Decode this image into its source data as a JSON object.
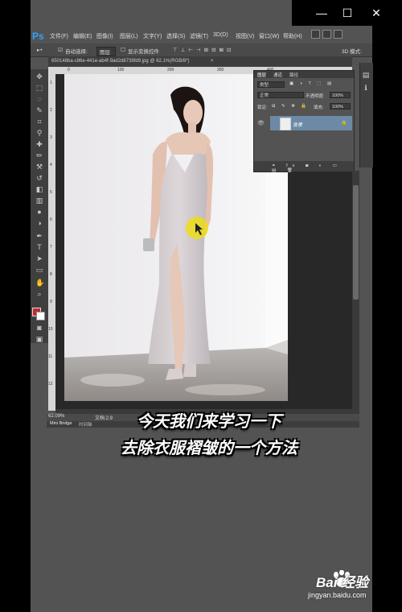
{
  "window": {
    "minimize": "—",
    "maximize": "☐",
    "close": "✕"
  },
  "app": {
    "logo": "Ps"
  },
  "menu": [
    "文件(F)",
    "编辑(E)",
    "图像(I)",
    "图层(L)",
    "文字(Y)",
    "选择(S)",
    "滤镜(T)",
    "3D(D)",
    "视图(V)",
    "窗口(W)",
    "帮助(H)"
  ],
  "options": {
    "auto_select": "自动选择:",
    "group": "图层",
    "show_transform": "显示变换控件",
    "mode3d": "3D 模式:"
  },
  "document": {
    "tab_title": "650148ba-c86e-441e-ab4f-9ad2d8739fd9.jpg @ 62.1%(RGB/8*)",
    "close": "×"
  },
  "ruler": {
    "top": [
      "0",
      "100",
      "200",
      "300",
      "400"
    ],
    "left": [
      "1",
      "2",
      "3",
      "4",
      "5",
      "6",
      "7",
      "8",
      "9",
      "10",
      "11",
      "12"
    ]
  },
  "layers_panel": {
    "tabs": [
      "图层",
      "通道",
      "路径"
    ],
    "filter": "类型",
    "blend_mode": "正常",
    "opacity_label": "不透明度:",
    "opacity": "100%",
    "lock_label": "锁定:",
    "fill_label": "填充:",
    "fill": "100%",
    "layer_name": "背景"
  },
  "status": {
    "zoom": "62.09%",
    "doc": "文档:2.9"
  },
  "bottom_tabs": [
    "Mini Bridge",
    "时间轴"
  ],
  "caption": {
    "line1": "今天我们来学习一下",
    "line2": "去除衣服褶皱的一个方法"
  },
  "watermark": {
    "brand": "Bai  经验",
    "url": "jingyan.baidu.com"
  },
  "colors": {
    "foreground": "#c42a2a",
    "background": "#ffffff",
    "accent": "#2fa3ff"
  }
}
